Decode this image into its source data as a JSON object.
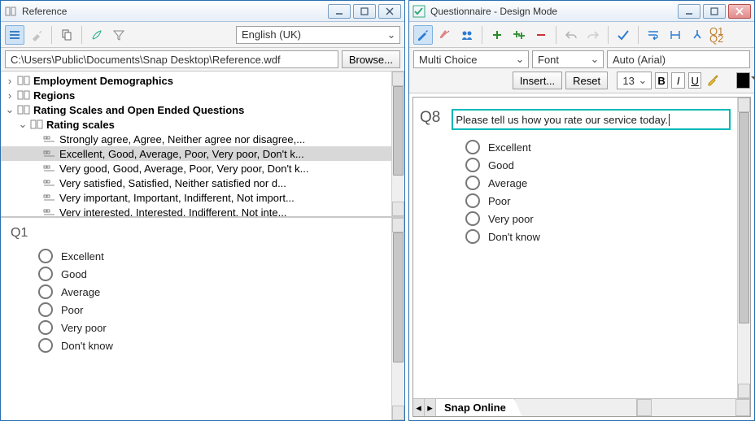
{
  "left": {
    "title": "Reference",
    "language": "English (UK)",
    "path": "C:\\Users\\Public\\Documents\\Snap Desktop\\Reference.wdf",
    "browse_label": "Browse...",
    "tree": [
      {
        "label": "Employment Demographics",
        "bold": true,
        "indent": 0,
        "exp": "closed",
        "icon": "book"
      },
      {
        "label": "Regions",
        "bold": true,
        "indent": 0,
        "exp": "closed",
        "icon": "book"
      },
      {
        "label": "Rating Scales and Open Ended Questions",
        "bold": true,
        "indent": 0,
        "exp": "open",
        "icon": "book"
      },
      {
        "label": "Rating scales",
        "bold": true,
        "indent": 1,
        "exp": "open",
        "icon": "book"
      },
      {
        "label": "Strongly agree, Agree, Neither agree nor disagree,...",
        "bold": false,
        "indent": 2,
        "exp": "none",
        "icon": "scale"
      },
      {
        "label": "Excellent, Good, Average, Poor, Very poor, Don't k...",
        "bold": false,
        "indent": 2,
        "exp": "none",
        "icon": "scale",
        "selected": true
      },
      {
        "label": "Very good, Good, Average, Poor, Very poor, Don't k...",
        "bold": false,
        "indent": 2,
        "exp": "none",
        "icon": "scale"
      },
      {
        "label": "Very satisfied, Satisfied, Neither satisfied nor d...",
        "bold": false,
        "indent": 2,
        "exp": "none",
        "icon": "scale"
      },
      {
        "label": "Very important, Important, Indifferent, Not import...",
        "bold": false,
        "indent": 2,
        "exp": "none",
        "icon": "scale"
      },
      {
        "label": "Very interested, Interested, Indifferent, Not inte...",
        "bold": false,
        "indent": 2,
        "exp": "none",
        "icon": "scale"
      }
    ],
    "preview": {
      "qnum": "Q1",
      "options": [
        "Excellent",
        "Good",
        "Average",
        "Poor",
        "Very poor",
        "Don't know"
      ]
    }
  },
  "right": {
    "title": "Questionnaire - Design Mode",
    "type_combo": "Multi Choice",
    "font_combo_label": "Font",
    "font_value": "Auto (Arial)",
    "insert_label": "Insert...",
    "reset_label": "Reset",
    "size_value": "13",
    "stack_small": {
      "top": "Q1",
      "bottom": "Q2"
    },
    "fmt_b": "B",
    "fmt_i": "I",
    "fmt_u": "U",
    "question": {
      "id": "Q8",
      "text": "Please tell us how you rate our service today.",
      "options": [
        "Excellent",
        "Good",
        "Average",
        "Poor",
        "Very poor",
        "Don't know"
      ]
    },
    "tab_label": "Snap Online"
  }
}
